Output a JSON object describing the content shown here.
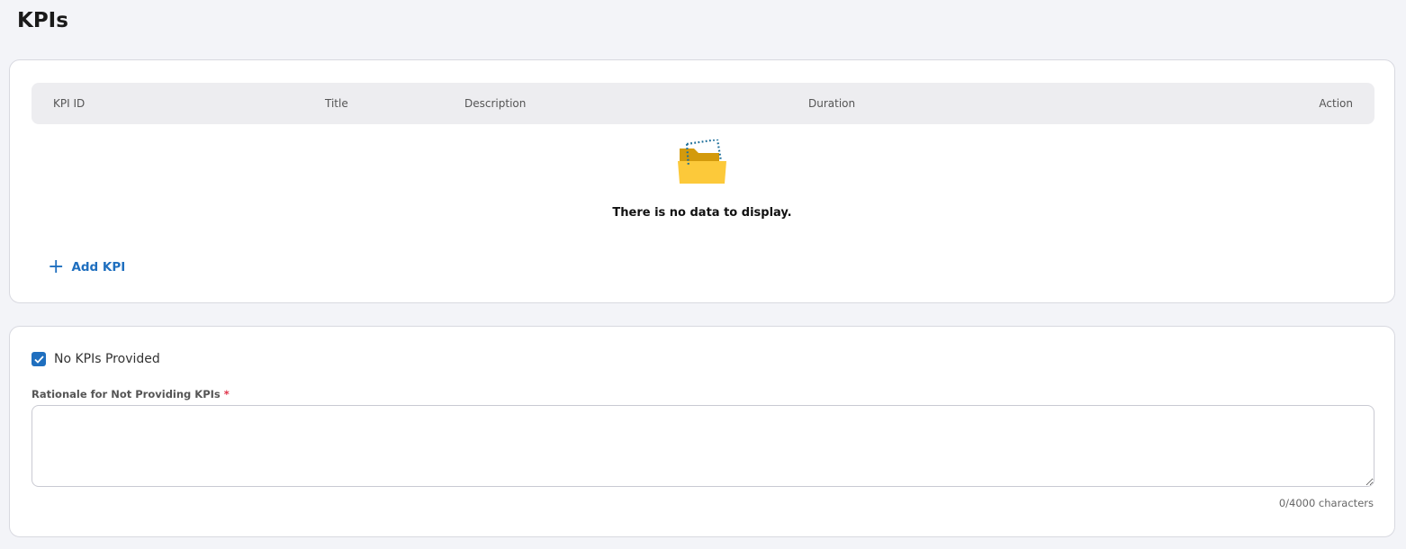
{
  "page": {
    "title": "KPIs"
  },
  "table": {
    "columns": [
      "KPI ID",
      "Title",
      "Description",
      "Duration",
      "Action"
    ],
    "empty_text": "There is no data to display.",
    "add_label": "Add KPI"
  },
  "form": {
    "checkbox_label": "No KPIs Provided",
    "checkbox_checked": true,
    "rationale_label": "Rationale for Not Providing KPIs",
    "required_mark": "*",
    "rationale_value": "",
    "char_count": "0/4000 characters"
  },
  "colors": {
    "accent": "#1f6fbf",
    "required": "#e0334a"
  }
}
